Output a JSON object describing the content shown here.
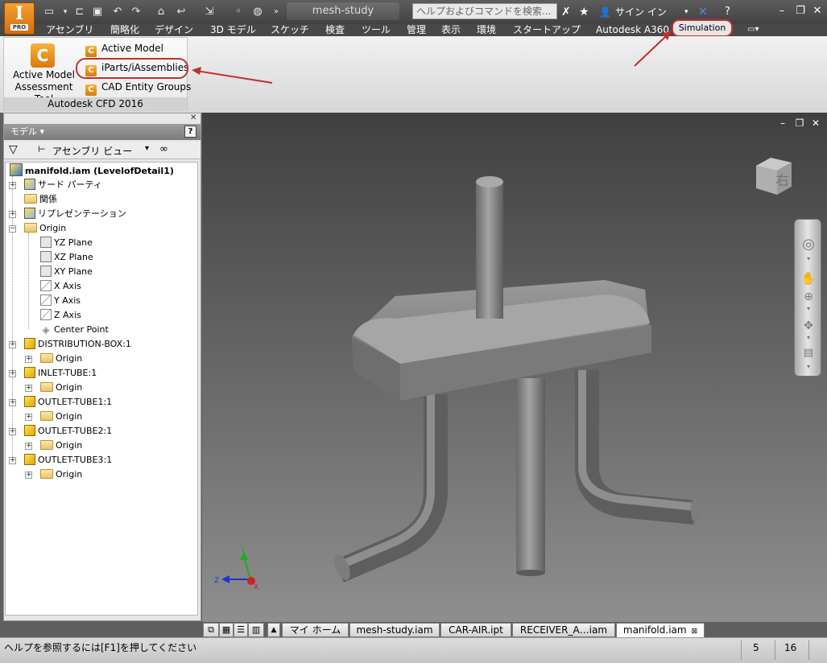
{
  "titlebar": {
    "app_icon_letter": "I",
    "app_icon_badge": "PRO",
    "document_title": "mesh-study",
    "search_placeholder": "ヘルプおよびコマンドを検索...",
    "signin_label": "サイン イン",
    "quick_access_icons": [
      "new-icon",
      "open-icon",
      "save-icon",
      "undo-icon",
      "redo-icon",
      "home-icon",
      "return-icon",
      "select-icon",
      "color-icon",
      "material-icon",
      "more-icon"
    ]
  },
  "menu": {
    "tabs": [
      "アセンブリ",
      "簡略化",
      "デザイン",
      "3D モデル",
      "スケッチ",
      "検査",
      "ツール",
      "管理",
      "表示",
      "環境",
      "スタートアップ",
      "Autodesk A360",
      "Simulation"
    ],
    "active_tab": "Simulation"
  },
  "ribbon": {
    "panel_title": "Autodesk CFD 2016",
    "large_button_label_line1": "Active Model",
    "large_button_label_line2": "Assessment Tool",
    "small_buttons": [
      "Active Model",
      "iParts/iAssemblies",
      "CAD Entity Groups"
    ],
    "highlight_color": "#c0312b"
  },
  "browser": {
    "header": "モデル",
    "help_glyph": "?",
    "view_label": "アセンブリ ビュー",
    "tree": [
      {
        "label": "manifold.iam (LevelofDetail1)",
        "icon": "assembly-icon",
        "bold": true
      },
      {
        "label": "サード パーティ",
        "icon": "third-party-icon"
      },
      {
        "label": "関係",
        "icon": "folder-icon"
      },
      {
        "label": "リプレゼンテーション",
        "icon": "representation-icon"
      },
      {
        "label": "Origin",
        "icon": "folder-open-icon"
      },
      {
        "label": "YZ Plane",
        "icon": "plane-icon"
      },
      {
        "label": "XZ Plane",
        "icon": "plane-icon"
      },
      {
        "label": "XY Plane",
        "icon": "plane-icon"
      },
      {
        "label": "X Axis",
        "icon": "axis-icon"
      },
      {
        "label": "Y Axis",
        "icon": "axis-icon"
      },
      {
        "label": "Z Axis",
        "icon": "axis-icon"
      },
      {
        "label": "Center Point",
        "icon": "point-icon"
      },
      {
        "label": "DISTRIBUTION-BOX:1",
        "icon": "component-icon"
      },
      {
        "label": "Origin",
        "icon": "folder-icon"
      },
      {
        "label": "INLET-TUBE:1",
        "icon": "component-icon"
      },
      {
        "label": "Origin",
        "icon": "folder-icon"
      },
      {
        "label": "OUTLET-TUBE1:1",
        "icon": "component-icon"
      },
      {
        "label": "Origin",
        "icon": "folder-icon"
      },
      {
        "label": "OUTLET-TUBE2:1",
        "icon": "component-icon"
      },
      {
        "label": "Origin",
        "icon": "folder-icon"
      },
      {
        "label": "OUTLET-TUBE3:1",
        "icon": "component-icon"
      },
      {
        "label": "Origin",
        "icon": "folder-icon"
      }
    ]
  },
  "viewport": {
    "viewcube_label": "右",
    "triad": {
      "x": "X",
      "y": "Y",
      "z": "Z"
    },
    "part_color": "#8a8a8a"
  },
  "doc_tabs": [
    "マイ ホーム",
    "mesh-study.iam",
    "CAR-AIR.ipt",
    "RECEIVER_A…iam",
    "manifold.iam"
  ],
  "active_doc_tab": "manifold.iam",
  "status": {
    "help_text": "ヘルプを参照するには[F1]を押してください",
    "value1": "5",
    "value2": "16"
  }
}
